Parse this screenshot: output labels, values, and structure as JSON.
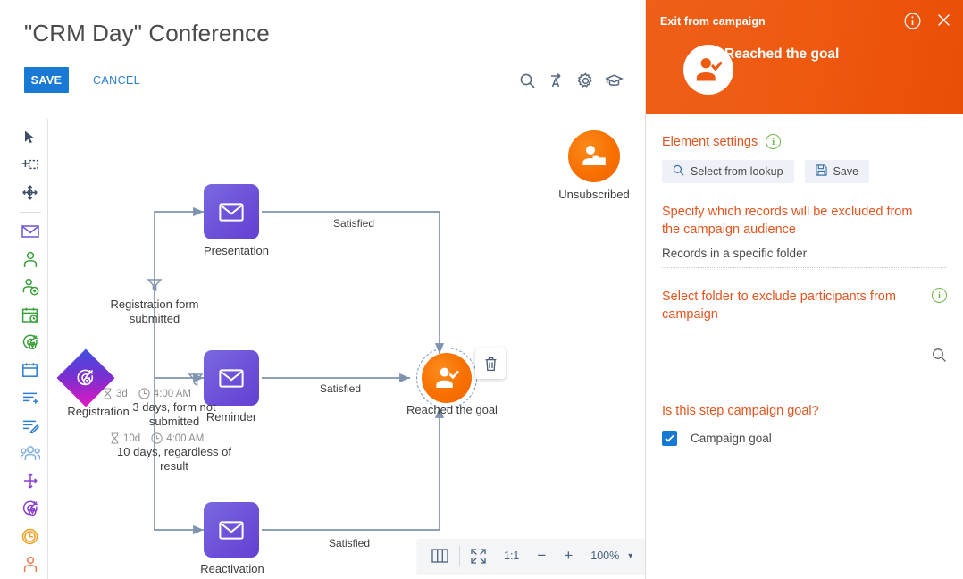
{
  "header": {
    "title": "\"CRM Day\" Conference",
    "save_label": "SAVE",
    "cancel_label": "CANCEL",
    "tools": [
      {
        "name": "search-icon",
        "label": "Search"
      },
      {
        "name": "text-translate-icon",
        "label": "Translate"
      },
      {
        "name": "gear-icon",
        "label": "Settings"
      },
      {
        "name": "graduation-cap-icon",
        "label": "Learning"
      }
    ]
  },
  "palette": {
    "items": [
      {
        "name": "cursor-icon",
        "label": "Select"
      },
      {
        "name": "add-selection-icon",
        "label": "Add area"
      },
      {
        "name": "pan-move-icon",
        "label": "Pan"
      },
      {
        "name": "email-icon",
        "label": "Email"
      },
      {
        "name": "person-icon",
        "label": "Audience"
      },
      {
        "name": "person-add-icon",
        "label": "Add participant"
      },
      {
        "name": "calendar-green-icon",
        "label": "Event"
      },
      {
        "name": "target-green-icon",
        "label": "Goal"
      },
      {
        "name": "calendar-blue-icon",
        "label": "Schedule"
      },
      {
        "name": "list-add-icon",
        "label": "Add to list"
      },
      {
        "name": "list-edit-icon",
        "label": "Edit list"
      },
      {
        "name": "audience-group-icon",
        "label": "Audience group"
      },
      {
        "name": "split-flow-icon",
        "label": "Split flow"
      },
      {
        "name": "target-purple-icon",
        "label": "Conditional goal"
      },
      {
        "name": "clock-icon",
        "label": "Timer"
      },
      {
        "name": "person-orange-icon",
        "label": "Exit"
      }
    ]
  },
  "canvas": {
    "nodes": [
      {
        "id": "registration",
        "label": "Registration",
        "type": "start-diamond"
      },
      {
        "id": "presentation",
        "label": "Presentation",
        "type": "email"
      },
      {
        "id": "reminder",
        "label": "Reminder",
        "type": "email"
      },
      {
        "id": "reactivation",
        "label": "Reactivation",
        "type": "email"
      },
      {
        "id": "reached-the-goal",
        "label": "Reached the goal",
        "type": "exit-goal",
        "selected": true
      },
      {
        "id": "unsubscribed",
        "label": "Unsubscribed",
        "type": "exit-unsubscribe"
      }
    ],
    "edge_labels": {
      "registration_form_submitted": "Registration form\nsubmitted",
      "satisfied_top": "Satisfied",
      "satisfied_mid": "Satisfied",
      "satisfied_bottom": "Satisfied"
    },
    "timers": [
      {
        "days": "3d",
        "time": "4:00 AM",
        "caption": "3 days, form not\nsubmitted"
      },
      {
        "days": "10d",
        "time": "4:00 AM",
        "caption": "10 days, regardless of\nresult"
      }
    ],
    "delete_button": {
      "name": "delete-node-button",
      "icon": "trash-icon"
    }
  },
  "zoombar": {
    "panel_icon": "layout-panel-icon",
    "fit_icon": "fit-to-screen-icon",
    "one_to_one": "1:1",
    "minus": "−",
    "plus": "+",
    "zoom_level": "100%",
    "caret": "▾"
  },
  "panel": {
    "header_title": "Exit from campaign",
    "info_icon": "info-icon",
    "close_icon": "close-icon",
    "avatar_icon": "person-check-icon",
    "step_name": "Reached the goal",
    "element_settings_label": "Element settings",
    "select_from_lookup_label": "Select from lookup",
    "save_label": "Save",
    "exclude_question": "Specify which records will be excluded from the campaign audience",
    "exclude_value": "Records in a specific folder",
    "folder_question": "Select folder to exclude participants from campaign",
    "folder_value": "",
    "goal_question": "Is this step campaign goal?",
    "goal_checkbox_label": "Campaign goal",
    "goal_checked": true
  },
  "colors": {
    "orange": "#ef5a11",
    "orange_text": "#e2551f",
    "blue": "#187ad4",
    "purple_node": "#6d50d8",
    "edge": "#7e93ad",
    "green_info": "#6fb847"
  }
}
